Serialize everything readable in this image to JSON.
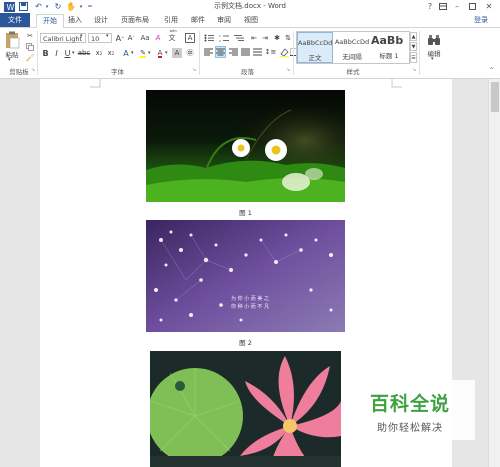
{
  "titlebar": {
    "title": "示例文档.docx - Word",
    "help": "?"
  },
  "tabs": [
    "文件",
    "开始",
    "插入",
    "设计",
    "页面布局",
    "引用",
    "邮件",
    "审阅",
    "视图"
  ],
  "login": "登录",
  "ribbon": {
    "clipboard": {
      "paste": "粘贴",
      "label": "剪贴板"
    },
    "font": {
      "name": "Calibri Light",
      "size": "10",
      "label": "字体",
      "aa": "Aa",
      "wen": "wén",
      "a_box": "A"
    },
    "paragraph": {
      "label": "段落"
    },
    "styles": {
      "items": [
        {
          "preview": "AaBbCcDd",
          "name": "正文"
        },
        {
          "preview": "AaBbCcDd",
          "name": "无间隔"
        },
        {
          "preview": "AaBb",
          "name": "标题 1"
        }
      ],
      "label": "样式"
    },
    "editing": {
      "label": "编辑"
    }
  },
  "document": {
    "captions": [
      "图 1",
      "图 2"
    ],
    "image2_text": [
      "为 你 小 而 美 之",
      "你 种 小 而 不 凡"
    ]
  },
  "watermark": {
    "title": "百科全说",
    "subtitle": "助你轻松解决"
  },
  "colors": {
    "accent": "#2b579a",
    "highlight": "#ffff00",
    "font_color": "#e81123",
    "watermark_green": "#3fa142"
  }
}
